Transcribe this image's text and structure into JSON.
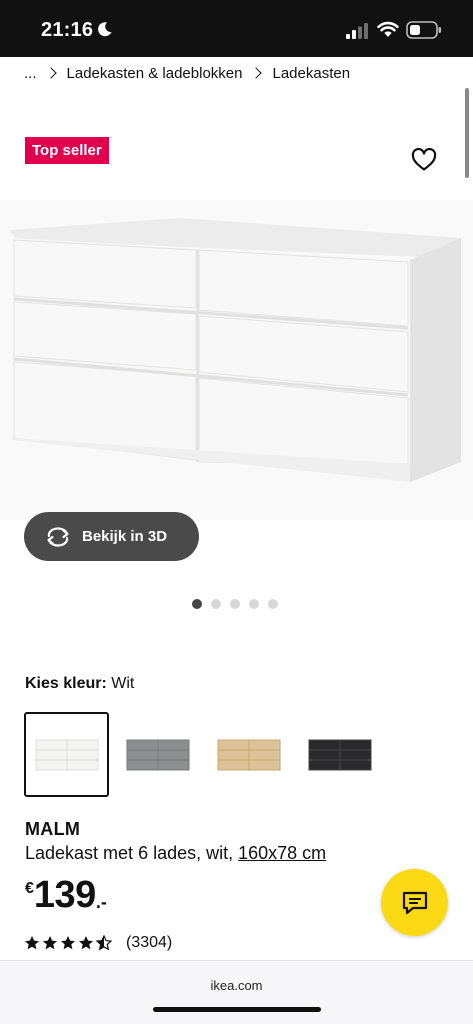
{
  "status_bar": {
    "time": "21:16"
  },
  "breadcrumb": {
    "ellipsis": "...",
    "items": [
      "Ladekasten & ladeblokken",
      "Ladekasten"
    ]
  },
  "product": {
    "badge": "Top seller",
    "view3d_label": "Bekijk in 3D",
    "image_count": 5,
    "active_image_index": 0,
    "color_label": "Kies kleur:",
    "color_value": "Wit",
    "colors": [
      {
        "name": "wit",
        "hex": "#f4f4f2",
        "selected": true
      },
      {
        "name": "grijs",
        "hex": "#8c8e90",
        "selected": false
      },
      {
        "name": "eiken",
        "hex": "#dcc296",
        "selected": false
      },
      {
        "name": "zwart",
        "hex": "#2a2a2c",
        "selected": false
      }
    ],
    "name": "MALM",
    "description": "Ladekast met 6 lades, wit,",
    "dimensions": "160x78 cm",
    "price": {
      "currency": "€",
      "amount": "139",
      "suffix": ".-"
    },
    "rating": {
      "value": 4.5,
      "max": 5,
      "count": "(3304)"
    }
  },
  "browser": {
    "url": "ikea.com"
  },
  "colors": {
    "badge": "#e0004d",
    "chat": "#fbd914",
    "button_dark": "#4a4a4a"
  },
  "icons": [
    "moon-icon",
    "signal-icon",
    "wifi-icon",
    "battery-icon",
    "heart-icon",
    "rotate-3d-icon",
    "chat-icon",
    "star-icon"
  ]
}
